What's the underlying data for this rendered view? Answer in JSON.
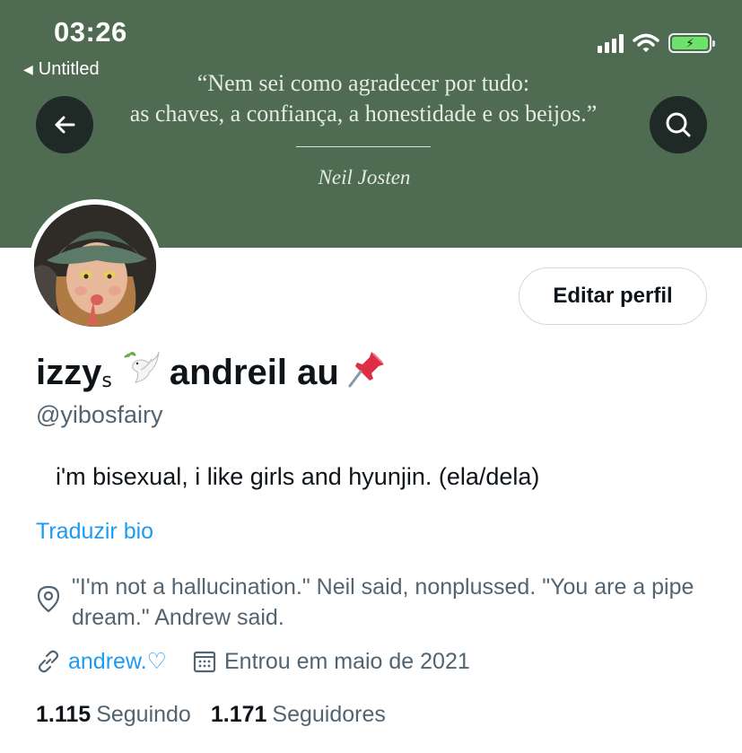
{
  "status_bar": {
    "time": "03:26",
    "back_app": "Untitled",
    "battery_color": "#6ee36b"
  },
  "banner": {
    "background_color": "#4f6b52",
    "quote_line1": "“Nem sei como agradecer por tudo:",
    "quote_line2": "as chaves, a confiança, a honestidade e os beijos.”",
    "quote_author": "Neil Josten"
  },
  "header": {
    "back_icon": "arrow-left-icon",
    "search_icon": "search-icon"
  },
  "profile": {
    "edit_button": "Editar perfil",
    "name_part1": "izzy",
    "name_small": "ꜱ",
    "name_part2": "andreil au",
    "name_icons": [
      "dove-icon",
      "pushpin-icon"
    ],
    "handle": "@yibosfairy",
    "bio": "i'm bisexual, i like girls and hyunjin. (ela/dela)",
    "translate_bio": "Traduzir bio",
    "location": "\"I'm not a hallucination.\" Neil said, nonplussed. \"You are a pipe dream.\" Andrew said.",
    "link": "andrew.♡",
    "joined": "Entrou em maio de 2021",
    "following_count": "1.115",
    "following_label": "Seguindo",
    "followers_count": "1.171",
    "followers_label": "Seguidores"
  },
  "colors": {
    "accent": "#1d9bf0",
    "secondary_text": "#536471",
    "primary_text": "#0f1419"
  }
}
